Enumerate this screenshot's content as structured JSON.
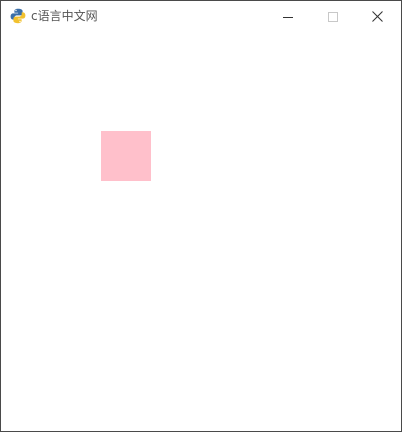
{
  "window": {
    "title": "c语言中文网",
    "app_icon": "python-icon",
    "controls": {
      "minimize_icon": "minimize-icon",
      "maximize_icon": "maximize-icon",
      "close_icon": "close-icon"
    }
  },
  "canvas": {
    "background": "#ffffff",
    "shapes": [
      {
        "type": "rectangle",
        "color": "#ffc0cb"
      }
    ]
  }
}
